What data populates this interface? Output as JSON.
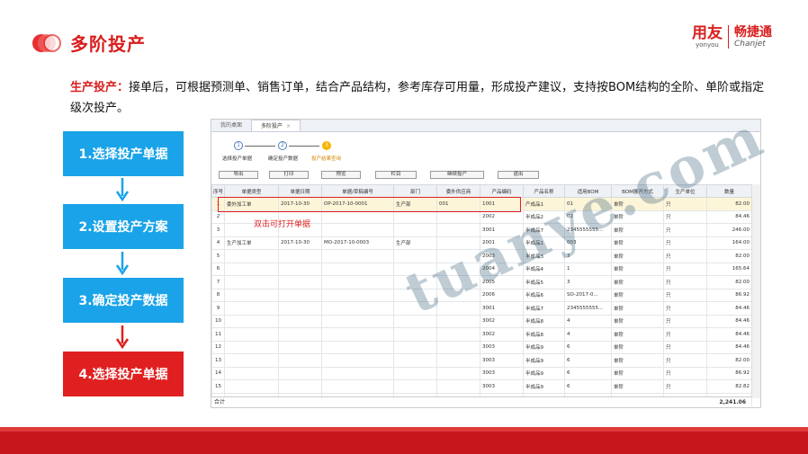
{
  "header": {
    "title": "多阶投产"
  },
  "brand": {
    "yonyou_cn": "用友",
    "yonyou_en": "yonyou",
    "chanjet_cn": "畅捷通",
    "chanjet_en": "Chanjet"
  },
  "description": {
    "term": "生产投产：",
    "text": "接单后，可根据预测单、销售订单，结合产品结构，参考库存可用量，形成投产建议，支持按BOM结构的全阶、单阶或指定级次投产。"
  },
  "steps": [
    {
      "label": "1.选择投产单据",
      "color": "#1aa3e8"
    },
    {
      "label": "2.设置投产方案",
      "color": "#1aa3e8"
    },
    {
      "label": "3.确定投产数据",
      "color": "#1aa3e8"
    },
    {
      "label": "4.选择投产单据",
      "color": "#e02020"
    }
  ],
  "screenshot": {
    "tabs": [
      {
        "label": "我的桌面"
      },
      {
        "label": "多阶投产",
        "close": "×"
      }
    ],
    "wizard": [
      {
        "num": "1",
        "label": "选择投产单据"
      },
      {
        "num": "2",
        "label": "确定投产数据"
      },
      {
        "num": "3",
        "label": "投产结果查询"
      }
    ],
    "toolbar": [
      "导出",
      "打印",
      "预览",
      "栏目",
      "继续投产",
      "退出"
    ],
    "columns": [
      "序号",
      "单据类型",
      "单据日期",
      "单据/草稿编号",
      "部门",
      "委外供应商",
      "产品编码",
      "产品名称",
      "适用BOM",
      "BOM展开方式",
      "生产单位",
      "数量"
    ],
    "rows": [
      [
        "1",
        "委外加工单",
        "2017-10-30",
        "OP-2017-10-0001",
        "生产部",
        "001",
        "1001",
        "产成品1",
        "01",
        "单阶",
        "只",
        "82.00"
      ],
      [
        "2",
        "",
        "",
        "",
        "",
        "",
        "2002",
        "半成品2",
        "02",
        "单阶",
        "只",
        "84.46"
      ],
      [
        "3",
        "",
        "",
        "",
        "",
        "",
        "3001",
        "半成品7",
        "2345555555...",
        "单阶",
        "只",
        "246.00"
      ],
      [
        "4",
        "生产加工单",
        "2017-10-30",
        "MO-2017-10-0003",
        "生产部",
        "",
        "2001",
        "半成品1",
        "003",
        "单阶",
        "只",
        "164.00"
      ],
      [
        "5",
        "",
        "",
        "",
        "",
        "",
        "2003",
        "半成品3",
        "3",
        "单阶",
        "只",
        "82.00"
      ],
      [
        "6",
        "",
        "",
        "",
        "",
        "",
        "2004",
        "半成品4",
        "1",
        "单阶",
        "只",
        "165.64"
      ],
      [
        "7",
        "",
        "",
        "",
        "",
        "",
        "2005",
        "半成品5",
        "3",
        "单阶",
        "只",
        "82.00"
      ],
      [
        "8",
        "",
        "",
        "",
        "",
        "",
        "2006",
        "半成品6",
        "SO-2017-0...",
        "单阶",
        "只",
        "86.92"
      ],
      [
        "9",
        "",
        "",
        "",
        "",
        "",
        "3001",
        "半成品7",
        "2345555555...",
        "单阶",
        "只",
        "84.46"
      ],
      [
        "10",
        "",
        "",
        "",
        "",
        "",
        "3002",
        "半成品8",
        "4",
        "单阶",
        "只",
        "84.46"
      ],
      [
        "11",
        "",
        "",
        "",
        "",
        "",
        "3002",
        "半成品8",
        "4",
        "单阶",
        "只",
        "84.46"
      ],
      [
        "12",
        "",
        "",
        "",
        "",
        "",
        "3003",
        "半成品9",
        "6",
        "单阶",
        "只",
        "84.46"
      ],
      [
        "13",
        "",
        "",
        "",
        "",
        "",
        "3003",
        "半成品9",
        "6",
        "单阶",
        "只",
        "82.00"
      ],
      [
        "14",
        "",
        "",
        "",
        "",
        "",
        "3003",
        "半成品9",
        "6",
        "单阶",
        "只",
        "86.92"
      ],
      [
        "15",
        "",
        "",
        "",
        "",
        "",
        "3003",
        "半成品9",
        "6",
        "单阶",
        "只",
        "82.82"
      ],
      [
        "16",
        "",
        "",
        "",
        "",
        "",
        "3004",
        "半成品10",
        "SO-2017-0...",
        "单阶",
        "只",
        "82.00"
      ]
    ],
    "total_label": "合计",
    "total_value": "2,241.06",
    "hint": "双击可打开单据"
  },
  "watermark": "tuanye.com",
  "colors": {
    "accent": "#d81e1e",
    "step_blue": "#1aa3e8",
    "step_red": "#e02020",
    "footer": "#c8161d"
  }
}
